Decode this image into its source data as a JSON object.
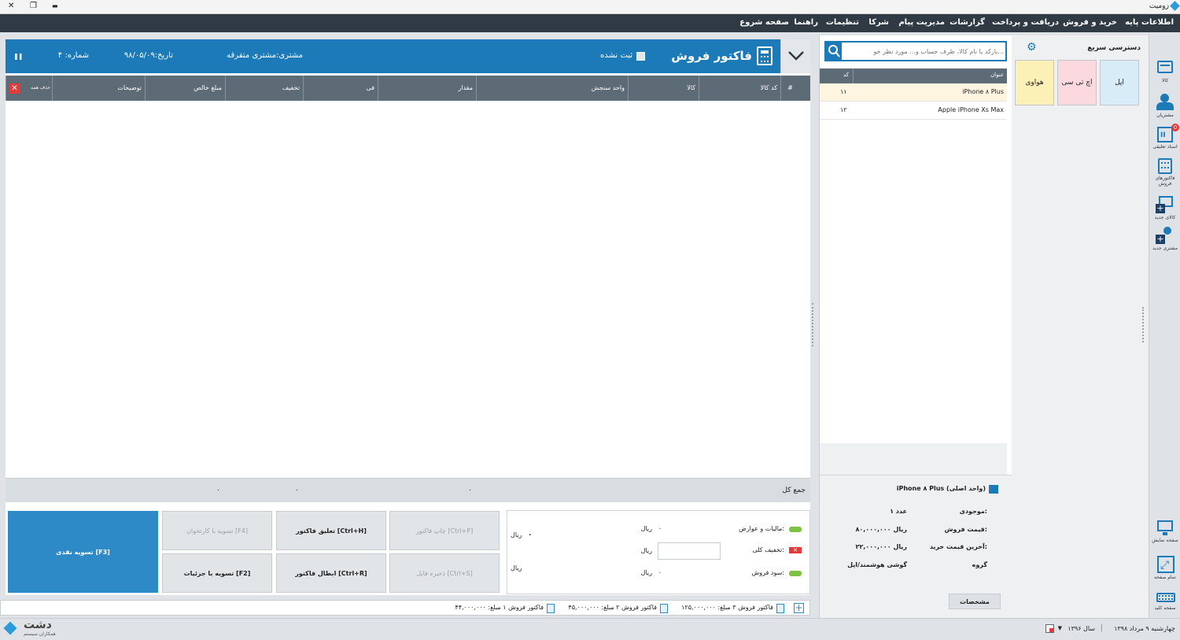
{
  "app": {
    "title": "زومیت"
  },
  "window_controls": {
    "close": "✕",
    "restore": "❐",
    "minimize": "▬"
  },
  "menu": [
    "اطلاعات پایه",
    "خرید و فروش",
    "دریافت و پرداخت",
    "گزارشات",
    "مدیریت پیام",
    "شرکا",
    "تنظیمات",
    "راهنما",
    "صفحه شروع"
  ],
  "invoice": {
    "title": "فاکتور فروش",
    "status": "ثبت نشده",
    "customer": "مشتری:مشتری متفرقه",
    "date": "تاریخ:۹۸/۰۵/۰۹",
    "number": "شماره: ۴",
    "columns": [
      "#",
      "کد کالا",
      "کالا",
      "واحد سنجش",
      "مقدار",
      "فی",
      "تخفیف",
      "مبلغ خالص",
      "توضیحات",
      "حذف همه"
    ],
    "total_label": "جمع کل",
    "total_values": [
      "۰",
      "۰",
      "۰"
    ]
  },
  "summary": {
    "tax_label": "مالیات و عوارض:",
    "tax_value": "۰",
    "discount_label": "تخفیف کلی:",
    "profit_label": "سود فروش:",
    "profit_value": "۰",
    "currency": "ریال",
    "grand_value": "۰"
  },
  "buttons": {
    "print": "چاپ فاکتور [Ctrl+P]",
    "suspend": "تعلیق فاکتور [Ctrl+H]",
    "card": "تسویه با کارتخوان [F4]",
    "cash": "تسویه نقدی [F3]",
    "save_draft": "ذخیره فایل [Ctrl+S]",
    "cancel": "ابطال فاکتور [Ctrl+R]",
    "detail": "تسویه با جزئیات [F2]"
  },
  "status_strip": [
    "فاکتور فروش ۳ مبلغ: ۱۲۵,۰۰۰,۰۰۰",
    "فاکتور فروش ۲ مبلغ: ۴۵,۰۰۰,۰۰۰",
    "فاکتور فروش ۱ مبلغ: ۴۴,۰۰۰,۰۰۰"
  ],
  "search": {
    "placeholder": "بارکد یا نام کالا، طرف حساب و... مورد نظر خو..."
  },
  "product_list": {
    "headers": {
      "title": "عنوان",
      "code": "کد"
    },
    "rows": [
      {
        "title": "iPhone ۸ Plus",
        "code": "۱۱"
      },
      {
        "title": "Apple iPhone Xs Max",
        "code": "۱۲"
      }
    ]
  },
  "product_info": {
    "name": "iPhone ۸ Plus (واحد اصلی)",
    "stock_label": "موجودی:",
    "stock_value": "۱ عدد",
    "price_label": "قیمت فروش:",
    "price_value": "۸۰,۰۰۰,۰۰۰ ریال",
    "last_buy_label": "آخرین قیمت خرید:",
    "last_buy_value": "۲۲,۰۰۰,۰۰۰ ریال",
    "group_label": "گروه",
    "group_value": "گوشی هوشمند/اپل",
    "spec_button": "مشخصات"
  },
  "quick_access": {
    "title": "دسترسی سریع",
    "tiles": [
      {
        "label": "اپل",
        "color": "#d8ecf8"
      },
      {
        "label": "اچ تی سی",
        "color": "#fbd9de"
      },
      {
        "label": "هواوی",
        "color": "#fbf0b5"
      }
    ]
  },
  "sidebar": {
    "items": [
      "کالا",
      "مشتریان",
      "اسناد تعلیقی",
      "فاکتورهای فروش",
      "کالای جدید",
      "مشتری جدید"
    ],
    "badge": "0",
    "bottom_items": [
      "صفحه نمایش",
      "تمام صفحه",
      "صفحه کلید"
    ]
  },
  "footer": {
    "date": "چهارشنبه ۹ مرداد ۱۳۹۸",
    "year": "سال ۱۳۹۶",
    "brand": "دشت",
    "brand_sub": "همکاران سیستم"
  },
  "colors": {
    "accent": "#1c7ab8",
    "header": "#2f3a44",
    "grid": "#5d6b77"
  }
}
